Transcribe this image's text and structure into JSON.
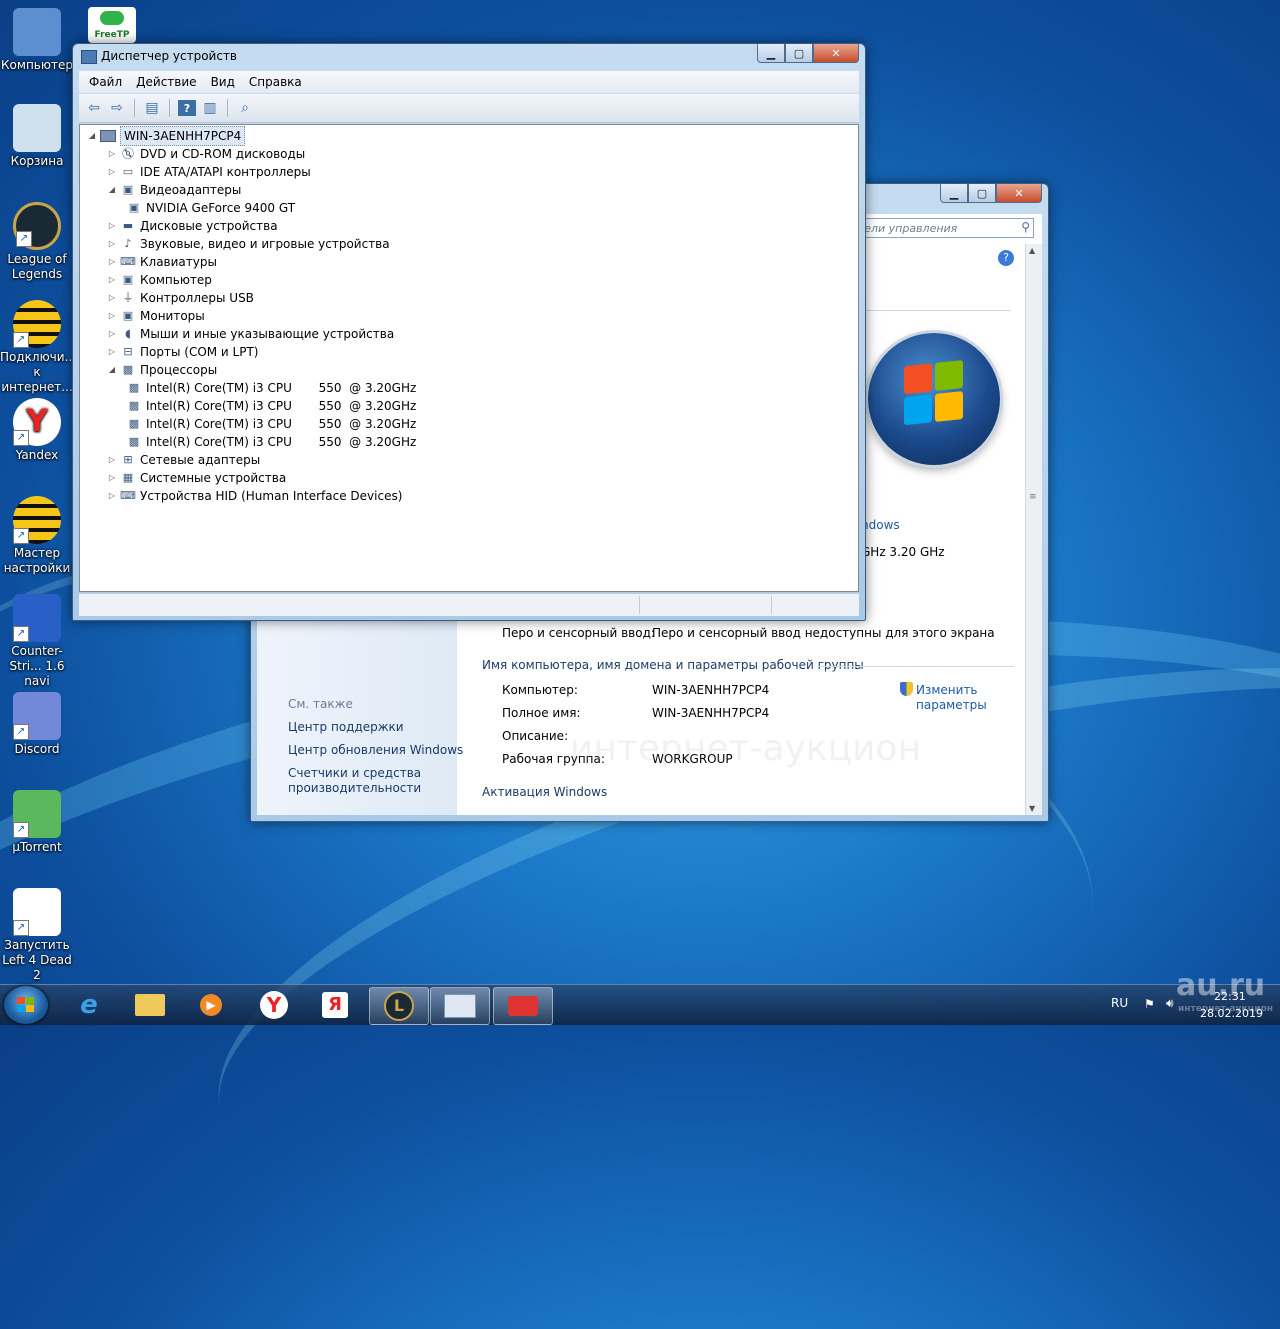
{
  "desktop": {
    "icons": [
      {
        "label": "Компьютер",
        "icon": "computer-icon"
      },
      {
        "label": "Корзина",
        "icon": "recycle-bin-icon"
      },
      {
        "label": "League of Legends",
        "icon": "league-of-legends-icon"
      },
      {
        "label": "Подключи... к интернет...",
        "icon": "beeline-icon"
      },
      {
        "label": "Yandex",
        "icon": "yandex-icon"
      },
      {
        "label": "Мастер настройки",
        "icon": "beeline-icon"
      },
      {
        "label": "Counter-Stri... 1.6 navi",
        "icon": "counter-strike-icon"
      },
      {
        "label": "Discord",
        "icon": "discord-icon"
      },
      {
        "label": "µTorrent",
        "icon": "utorrent-icon"
      },
      {
        "label": "Запустить Left 4 Dead 2",
        "icon": "left4dead-icon"
      }
    ],
    "top_partial_icon_label": "FreeTP"
  },
  "device_manager": {
    "title": "Диспетчер устройств",
    "menu": [
      "Файл",
      "Действие",
      "Вид",
      "Справка"
    ],
    "root": "WIN-3AENHH7PCP4",
    "tree": [
      {
        "label": "DVD и CD-ROM дисководы",
        "level": 1,
        "expanded": false,
        "icon": "dvd-drive-icon"
      },
      {
        "label": "IDE ATA/ATAPI контроллеры",
        "level": 1,
        "expanded": false,
        "icon": "ide-controller-icon"
      },
      {
        "label": "Видеоадаптеры",
        "level": 1,
        "expanded": true,
        "icon": "display-adapter-icon"
      },
      {
        "label": "NVIDIA GeForce 9400 GT",
        "level": 2,
        "icon": "display-adapter-icon"
      },
      {
        "label": "Дисковые устройства",
        "level": 1,
        "expanded": false,
        "icon": "disk-drive-icon"
      },
      {
        "label": "Звуковые, видео и игровые устройства",
        "level": 1,
        "expanded": false,
        "icon": "sound-icon"
      },
      {
        "label": "Клавиатуры",
        "level": 1,
        "expanded": false,
        "icon": "keyboard-icon"
      },
      {
        "label": "Компьютер",
        "level": 1,
        "expanded": false,
        "icon": "computer-icon"
      },
      {
        "label": "Контроллеры USB",
        "level": 1,
        "expanded": false,
        "icon": "usb-icon"
      },
      {
        "label": "Мониторы",
        "level": 1,
        "expanded": false,
        "icon": "monitor-icon"
      },
      {
        "label": "Мыши и иные указывающие устройства",
        "level": 1,
        "expanded": false,
        "icon": "mouse-icon"
      },
      {
        "label": "Порты (COM и LPT)",
        "level": 1,
        "expanded": false,
        "icon": "port-icon"
      },
      {
        "label": "Процессоры",
        "level": 1,
        "expanded": true,
        "icon": "processor-icon"
      },
      {
        "label": "Intel(R) Core(TM) i3 CPU       550  @ 3.20GHz",
        "level": 2,
        "icon": "processor-icon"
      },
      {
        "label": "Intel(R) Core(TM) i3 CPU       550  @ 3.20GHz",
        "level": 2,
        "icon": "processor-icon"
      },
      {
        "label": "Intel(R) Core(TM) i3 CPU       550  @ 3.20GHz",
        "level": 2,
        "icon": "processor-icon"
      },
      {
        "label": "Intel(R) Core(TM) i3 CPU       550  @ 3.20GHz",
        "level": 2,
        "icon": "processor-icon"
      },
      {
        "label": "Сетевые адаптеры",
        "level": 1,
        "expanded": false,
        "icon": "network-adapter-icon"
      },
      {
        "label": "Системные устройства",
        "level": 1,
        "expanded": false,
        "icon": "system-devices-icon"
      },
      {
        "label": "Устройства HID (Human Interface Devices)",
        "level": 1,
        "expanded": false,
        "icon": "hid-icon"
      }
    ]
  },
  "system_window": {
    "search_placeholder": "нели управления",
    "partial_link": "ndows",
    "partial_cpu": "GHz   3.20 GHz",
    "pen_label": "Перо и сенсорный ввод:",
    "pen_value": "Перо и сенсорный ввод недоступны для этого экрана",
    "section_name": "Имя компьютера, имя домена и параметры рабочей группы",
    "rows": [
      {
        "label": "Компьютер:",
        "value": "WIN-3AENHH7PCP4"
      },
      {
        "label": "Полное имя:",
        "value": "WIN-3AENHH7PCP4"
      },
      {
        "label": "Описание:",
        "value": ""
      },
      {
        "label": "Рабочая группа:",
        "value": "WORKGROUP"
      }
    ],
    "change_link": "Изменить параметры",
    "activation_header": "Активация Windows",
    "see_also": "См. также",
    "left_links": [
      "Центр поддержки",
      "Центр обновления Windows",
      "Счетчики и средства производительности"
    ]
  },
  "taskbar": {
    "language": "RU",
    "time": "22:31",
    "date": "28.02.2019"
  },
  "watermark": {
    "brand": "au.ru",
    "subtitle": "интернет-аукцион"
  }
}
